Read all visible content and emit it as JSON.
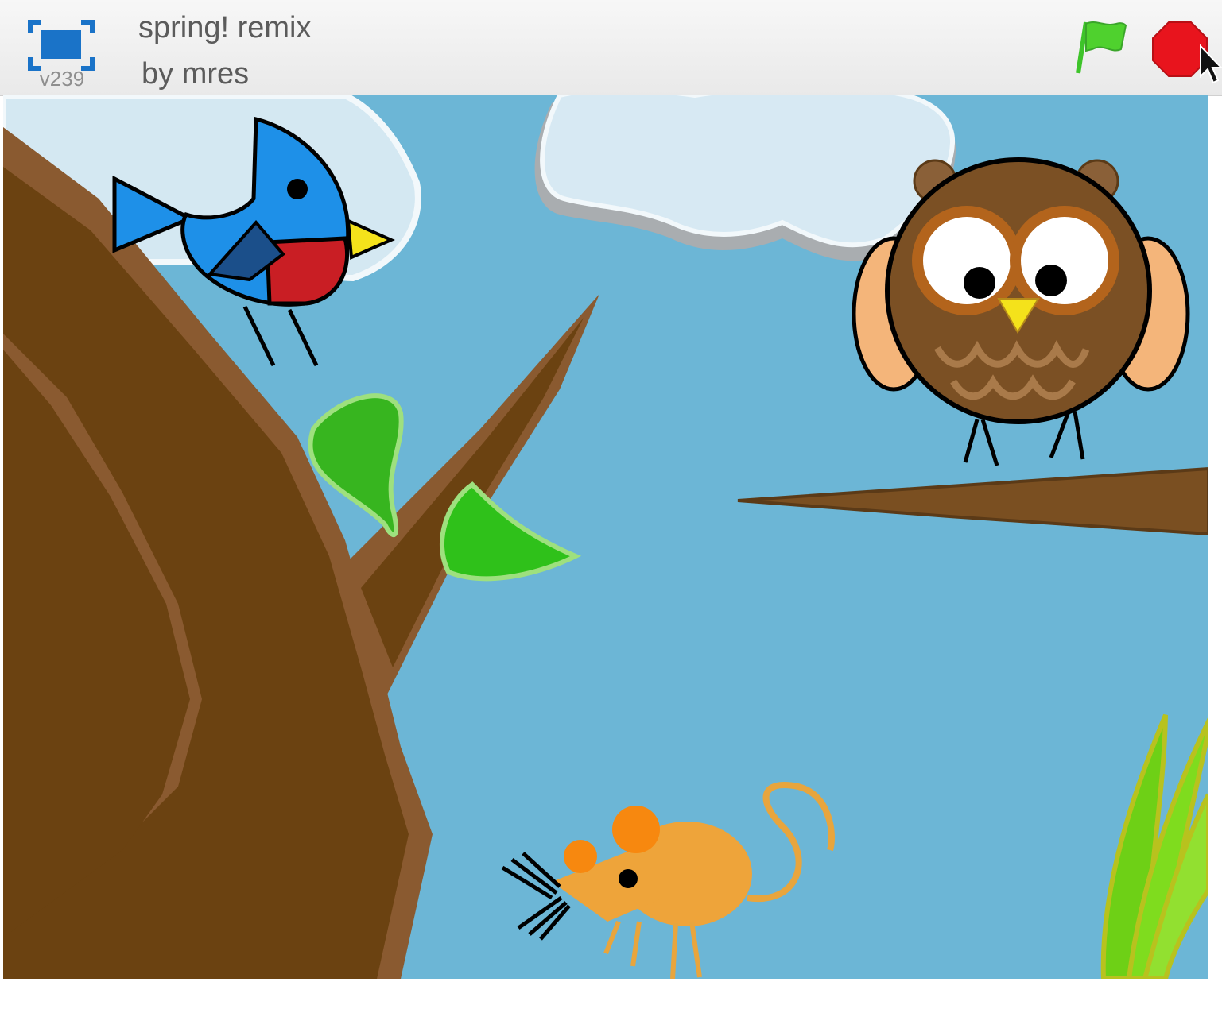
{
  "header": {
    "version_label": "v239",
    "title": "spring! remix",
    "author": "by mres"
  },
  "icons": {
    "fullscreen": "fullscreen-icon",
    "flag": "green-flag-icon",
    "stop": "stop-icon",
    "cursor": "mouse-pointer-icon"
  },
  "colors": {
    "sky": "#6cb6d6",
    "flag": "#4fd12e",
    "stop": "#e8141d",
    "accent": "#1a73c8"
  },
  "stage": {
    "sprites": [
      "blue-bird",
      "owl",
      "mouse",
      "tree",
      "branch",
      "grass",
      "clouds"
    ]
  }
}
